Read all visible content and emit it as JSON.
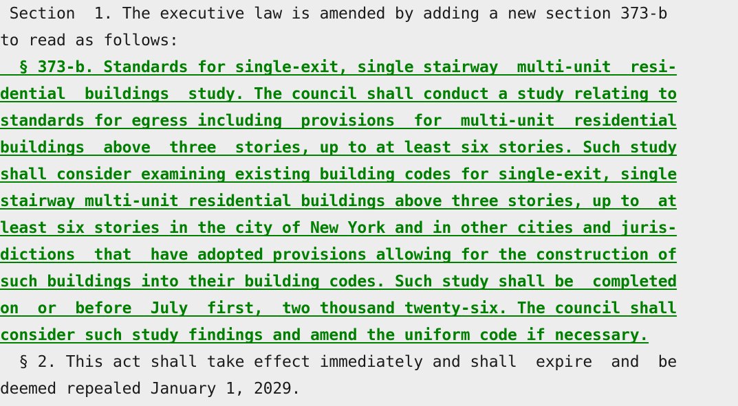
{
  "document": {
    "background_color": "#ededed",
    "plain_text_color": "#1b1b1b",
    "added_text_color": "#007f00",
    "lines": [
      {
        "id": "line-1",
        "style": "plain",
        "text": " Section  1. The executive law is amended by adding a new section 373-b"
      },
      {
        "id": "line-2",
        "style": "plain",
        "text": "to read as follows:"
      },
      {
        "id": "line-3",
        "style": "added",
        "text": "  § 373-b. Standards for single-exit, single stairway  multi-unit  resi-"
      },
      {
        "id": "line-4",
        "style": "added",
        "text": "dential  buildings  study. The council shall conduct a study relating to"
      },
      {
        "id": "line-5",
        "style": "added",
        "text": "standards for egress including  provisions  for  multi-unit  residential"
      },
      {
        "id": "line-6",
        "style": "added",
        "text": "buildings  above  three  stories, up to at least six stories. Such study"
      },
      {
        "id": "line-7",
        "style": "added",
        "text": "shall consider examining existing building codes for single-exit, single"
      },
      {
        "id": "line-8",
        "style": "added",
        "text": "stairway multi-unit residential buildings above three stories, up to  at"
      },
      {
        "id": "line-9",
        "style": "added",
        "text": "least six stories in the city of New York and in other cities and juris-"
      },
      {
        "id": "line-10",
        "style": "added",
        "text": "dictions  that  have adopted provisions allowing for the construction of"
      },
      {
        "id": "line-11",
        "style": "added",
        "text": "such buildings into their building codes. Such study shall be  completed"
      },
      {
        "id": "line-12",
        "style": "added",
        "text": "on  or  before  July  first,  two thousand twenty-six. The council shall"
      },
      {
        "id": "line-13",
        "style": "added",
        "text": "consider such study findings and amend the uniform code if necessary."
      },
      {
        "id": "line-14",
        "style": "plain",
        "text": "  § 2. This act shall take effect immediately and shall  expire  and  be"
      },
      {
        "id": "line-15",
        "style": "plain",
        "text": "deemed repealed January 1, 2029."
      }
    ]
  }
}
